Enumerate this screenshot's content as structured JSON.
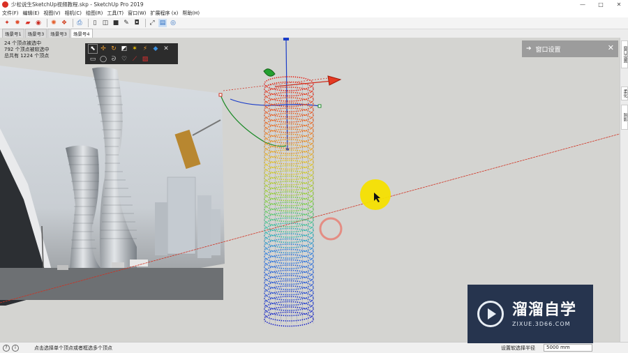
{
  "window": {
    "title": "少松说生SketchUp视频教程.skp - SketchUp Pro 2019",
    "minimize": "—",
    "maximize": "□",
    "close": "✕"
  },
  "menu": [
    "文件(F)",
    "编辑(E)",
    "视图(V)",
    "相机(C)",
    "绘图(R)",
    "工具(T)",
    "窗口(W)",
    "扩展程序 (x)",
    "帮助(H)"
  ],
  "toolbar": {
    "icons": [
      "select-icon",
      "eraser-icon",
      "paint-icon",
      "warehouse-icon",
      "gear-icon",
      "component-icon",
      "print-icon",
      "view-icon",
      "box-icon",
      "front-icon",
      "pencil-icon",
      "sandbox-icon",
      "move-icon",
      "zoom-icon"
    ]
  },
  "scenes": {
    "tabs": [
      "场景号1",
      "场景号3",
      "场景号3",
      "场景号4"
    ],
    "active_index": 3
  },
  "viewport": {
    "stats": [
      "24 个顶点被选中",
      "792 个顶点被软选中",
      "总共有 1224 个顶点"
    ]
  },
  "vertex_toolbar": {
    "icons": [
      "select-arrow-icon",
      "move-icon",
      "rotate-icon",
      "scale-icon",
      "soft-select-icon",
      "magic-wand-icon",
      "sculpt-icon",
      "split-icon",
      "rect-select-icon",
      "circle-select-icon",
      "lasso-icon",
      "paint-select-icon",
      "pin-icon",
      "clear-icon"
    ]
  },
  "panel": {
    "title": "窗口设置",
    "arrow": "➔",
    "close": "✕"
  },
  "side_tray": {
    "tabs": [
      "窗口设置",
      "柔化",
      "阴影"
    ]
  },
  "status": {
    "hint": "点击选择单个顶点或者框选多个顶点",
    "measure_label": "设置软选择半径",
    "measure_value": "5000 mm"
  },
  "watermark": {
    "title": "溜溜自学",
    "subtitle": "ZIXUE.3D66.COM"
  },
  "colors": {
    "viewport_bg": "#d4d4d1",
    "axis_red": "#d03020",
    "axis_blue": "#1a3cc8",
    "axis_green": "#1c8a28",
    "cursor_highlight": "#f5e000",
    "watermark_bg": "#26344e"
  }
}
